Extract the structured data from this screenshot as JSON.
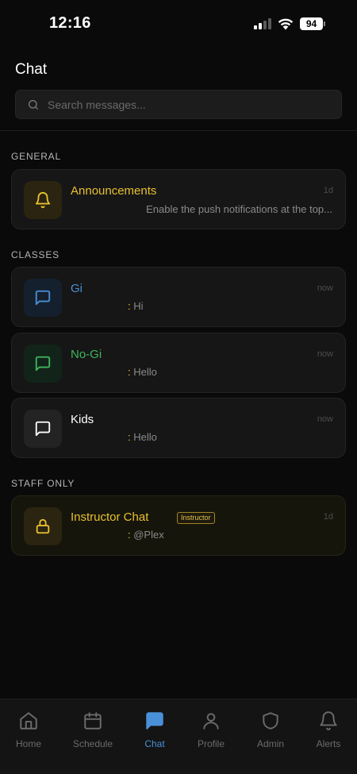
{
  "status_bar": {
    "time": "12:16",
    "battery": "94"
  },
  "header": {
    "title": "Chat"
  },
  "search": {
    "placeholder": "Search messages..."
  },
  "sections": {
    "general": {
      "label": "GENERAL"
    },
    "classes": {
      "label": "CLASSES"
    },
    "staff": {
      "label": "STAFF ONLY"
    }
  },
  "chats": {
    "announcements": {
      "title": "Announcements",
      "time": "1d",
      "preview": "Enable the push notifications at the top...",
      "icon": "bell-icon",
      "color": "#e8c030"
    },
    "gi": {
      "title": "Gi",
      "time": "now",
      "preview_colon": ":",
      "preview": " Hi",
      "icon": "message-square-icon",
      "color": "#4a8fd6"
    },
    "nogi": {
      "title": "No-Gi",
      "time": "now",
      "preview_colon": ":",
      "preview": " Hello",
      "icon": "message-square-icon",
      "color": "#3fb45e"
    },
    "kids": {
      "title": "Kids",
      "time": "now",
      "preview_colon": ":",
      "preview": " Hello",
      "icon": "message-square-icon",
      "color": "#ffffff"
    },
    "instructor": {
      "title": "Instructor Chat",
      "badge": "Instructor",
      "time": "1d",
      "preview_colon": ":",
      "preview": " @Plex",
      "icon": "lock-icon",
      "color": "#e8c030"
    }
  },
  "tabs": [
    {
      "label": "Home",
      "icon": "home-icon"
    },
    {
      "label": "Schedule",
      "icon": "calendar-icon"
    },
    {
      "label": "Chat",
      "icon": "chat-icon",
      "active": true
    },
    {
      "label": "Profile",
      "icon": "user-icon"
    },
    {
      "label": "Admin",
      "icon": "shield-icon"
    },
    {
      "label": "Alerts",
      "icon": "bell-icon"
    }
  ]
}
